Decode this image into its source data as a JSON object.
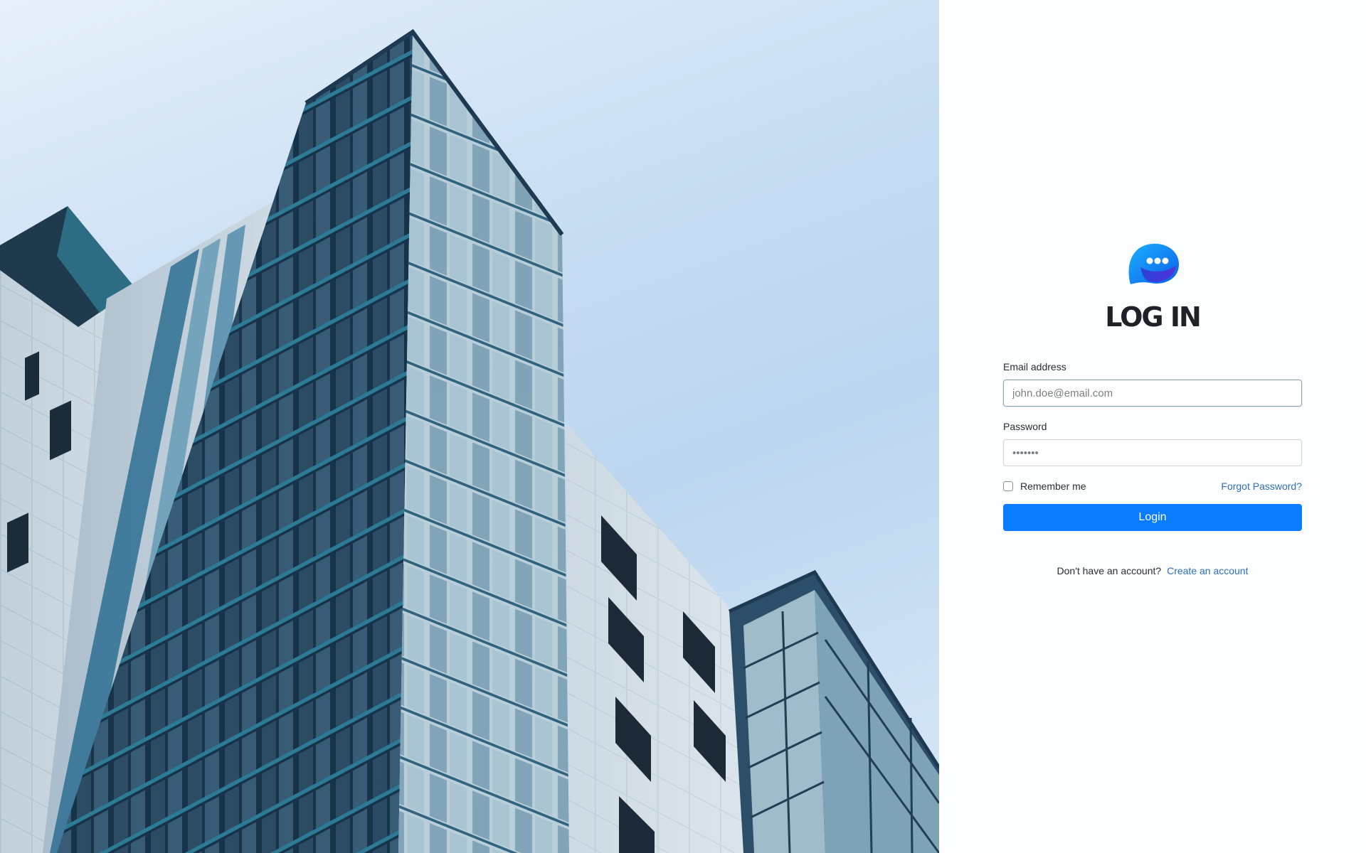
{
  "login": {
    "title": "LOG IN",
    "email_label": "Email address",
    "email_placeholder": "john.doe@email.com",
    "password_label": "Password",
    "password_placeholder": "•••••••",
    "remember_label": "Remember me",
    "forgot_label": "Forgot Password?",
    "submit_label": "Login",
    "signup_prompt": "Don't have an account?",
    "signup_link": "Create an account"
  },
  "icons": {
    "logo": "chat-bubble-logo",
    "hero": "office-building-photo"
  },
  "colors": {
    "primary": "#0a7cff",
    "link": "#2f6fb8",
    "title": "#1e2127",
    "panel_bg": "#fbfdfe"
  }
}
